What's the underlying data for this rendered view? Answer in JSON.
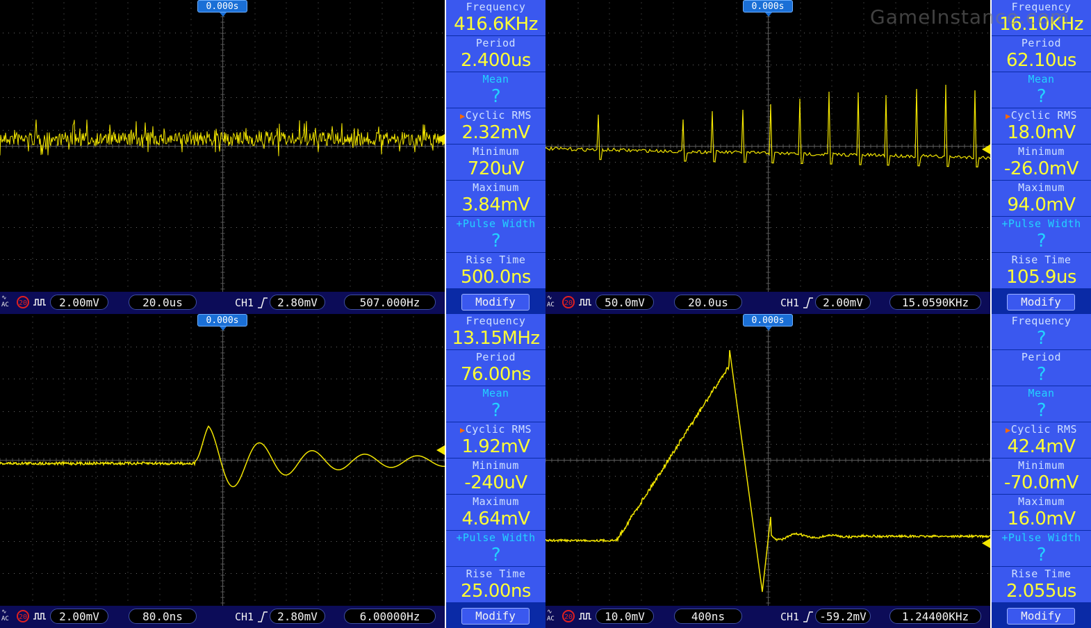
{
  "colors": {
    "trace": "#f3e600",
    "panel": "#3a58ef",
    "panel_bg": "#0a2aa6",
    "status_bar": "#0c0c58",
    "value": "#ffff35",
    "cyan": "#23d3ff"
  },
  "watermark": "GameInstance.com",
  "quadrants": [
    {
      "trigger_time": "0.000s",
      "status": {
        "coupling": "AC",
        "bw_limit": "20",
        "volts_div": "2.00mV",
        "time_div": "20.0us",
        "channel": "CH1",
        "trigger_level": "2.80mV",
        "counter": "507.000Hz"
      },
      "measurements": [
        {
          "label": "Frequency",
          "value": "416.6KHz"
        },
        {
          "label": "Period",
          "value": "2.400us"
        },
        {
          "label": "Mean",
          "value": "?"
        },
        {
          "label": "Cyclic RMS",
          "value": "2.32mV",
          "selected": true
        },
        {
          "label": "Minimum",
          "value": "720uV"
        },
        {
          "label": "Maximum",
          "value": "3.84mV"
        },
        {
          "label": "+Pulse Width",
          "value": "?"
        },
        {
          "label": "Rise Time",
          "value": "500.0ns"
        }
      ],
      "modify_label": "Modify"
    },
    {
      "trigger_time": "0.000s",
      "status": {
        "coupling": "AC",
        "bw_limit": "20",
        "volts_div": "50.0mV",
        "time_div": "20.0us",
        "channel": "CH1",
        "trigger_level": "2.00mV",
        "counter": "15.0590KHz"
      },
      "measurements": [
        {
          "label": "Frequency",
          "value": "16.10KHz"
        },
        {
          "label": "Period",
          "value": "62.10us"
        },
        {
          "label": "Mean",
          "value": "?"
        },
        {
          "label": "Cyclic RMS",
          "value": "18.0mV",
          "selected": true
        },
        {
          "label": "Minimum",
          "value": "-26.0mV"
        },
        {
          "label": "Maximum",
          "value": "94.0mV"
        },
        {
          "label": "+Pulse Width",
          "value": "?"
        },
        {
          "label": "Rise Time",
          "value": "105.9us"
        }
      ],
      "modify_label": "Modify"
    },
    {
      "trigger_time": "0.000s",
      "status": {
        "coupling": "AC",
        "bw_limit": "20",
        "volts_div": "2.00mV",
        "time_div": "80.0ns",
        "channel": "CH1",
        "trigger_level": "2.80mV",
        "counter": "6.00000Hz"
      },
      "measurements": [
        {
          "label": "Frequency",
          "value": "13.15MHz"
        },
        {
          "label": "Period",
          "value": "76.00ns"
        },
        {
          "label": "Mean",
          "value": "?"
        },
        {
          "label": "Cyclic RMS",
          "value": "1.92mV",
          "selected": true
        },
        {
          "label": "Minimum",
          "value": "-240uV"
        },
        {
          "label": "Maximum",
          "value": "4.64mV"
        },
        {
          "label": "+Pulse Width",
          "value": "?"
        },
        {
          "label": "Rise Time",
          "value": "25.00ns"
        }
      ],
      "modify_label": "Modify"
    },
    {
      "trigger_time": "0.000s",
      "status": {
        "coupling": "AC",
        "bw_limit": "20",
        "volts_div": "10.0mV",
        "time_div": "400ns",
        "channel": "CH1",
        "trigger_level": "-59.2mV",
        "counter": "1.24400KHz"
      },
      "measurements": [
        {
          "label": "Frequency",
          "value": "?"
        },
        {
          "label": "Period",
          "value": "?"
        },
        {
          "label": "Mean",
          "value": "?"
        },
        {
          "label": "Cyclic RMS",
          "value": "42.4mV",
          "selected": true
        },
        {
          "label": "Minimum",
          "value": "-70.0mV"
        },
        {
          "label": "Maximum",
          "value": "16.0mV"
        },
        {
          "label": "+Pulse Width",
          "value": "?"
        },
        {
          "label": "Rise Time",
          "value": "2.055us"
        }
      ],
      "modify_label": "Modify"
    }
  ]
}
